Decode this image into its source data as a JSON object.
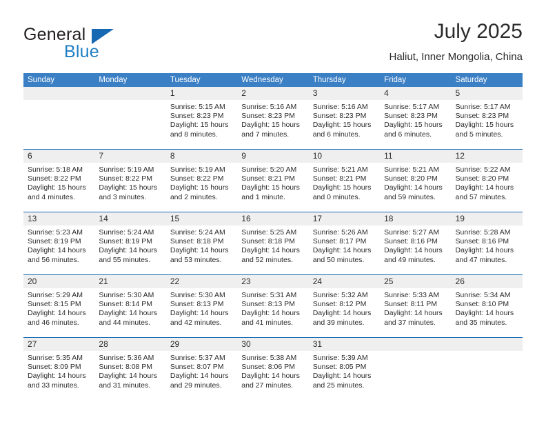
{
  "brand": {
    "name_part1": "General",
    "name_part2": "Blue",
    "triangle_color": "#1668b3",
    "blue_text_color": "#1f7fc4"
  },
  "header": {
    "title": "July 2025",
    "location": "Haliut, Inner Mongolia, China"
  },
  "theme": {
    "header_blue": "#3b7fc4",
    "separator_blue": "#1668b3",
    "number_band_gray": "#efefef",
    "text_color": "#2b2b2b"
  },
  "weekdays": [
    "Sunday",
    "Monday",
    "Tuesday",
    "Wednesday",
    "Thursday",
    "Friday",
    "Saturday"
  ],
  "weeks": [
    {
      "days": [
        {
          "num": "",
          "sunrise": "",
          "sunset": "",
          "daylight1": "",
          "daylight2": ""
        },
        {
          "num": "",
          "sunrise": "",
          "sunset": "",
          "daylight1": "",
          "daylight2": ""
        },
        {
          "num": "1",
          "sunrise": "Sunrise: 5:15 AM",
          "sunset": "Sunset: 8:23 PM",
          "daylight1": "Daylight: 15 hours",
          "daylight2": "and 8 minutes."
        },
        {
          "num": "2",
          "sunrise": "Sunrise: 5:16 AM",
          "sunset": "Sunset: 8:23 PM",
          "daylight1": "Daylight: 15 hours",
          "daylight2": "and 7 minutes."
        },
        {
          "num": "3",
          "sunrise": "Sunrise: 5:16 AM",
          "sunset": "Sunset: 8:23 PM",
          "daylight1": "Daylight: 15 hours",
          "daylight2": "and 6 minutes."
        },
        {
          "num": "4",
          "sunrise": "Sunrise: 5:17 AM",
          "sunset": "Sunset: 8:23 PM",
          "daylight1": "Daylight: 15 hours",
          "daylight2": "and 6 minutes."
        },
        {
          "num": "5",
          "sunrise": "Sunrise: 5:17 AM",
          "sunset": "Sunset: 8:23 PM",
          "daylight1": "Daylight: 15 hours",
          "daylight2": "and 5 minutes."
        }
      ]
    },
    {
      "days": [
        {
          "num": "6",
          "sunrise": "Sunrise: 5:18 AM",
          "sunset": "Sunset: 8:22 PM",
          "daylight1": "Daylight: 15 hours",
          "daylight2": "and 4 minutes."
        },
        {
          "num": "7",
          "sunrise": "Sunrise: 5:19 AM",
          "sunset": "Sunset: 8:22 PM",
          "daylight1": "Daylight: 15 hours",
          "daylight2": "and 3 minutes."
        },
        {
          "num": "8",
          "sunrise": "Sunrise: 5:19 AM",
          "sunset": "Sunset: 8:22 PM",
          "daylight1": "Daylight: 15 hours",
          "daylight2": "and 2 minutes."
        },
        {
          "num": "9",
          "sunrise": "Sunrise: 5:20 AM",
          "sunset": "Sunset: 8:21 PM",
          "daylight1": "Daylight: 15 hours",
          "daylight2": "and 1 minute."
        },
        {
          "num": "10",
          "sunrise": "Sunrise: 5:21 AM",
          "sunset": "Sunset: 8:21 PM",
          "daylight1": "Daylight: 15 hours",
          "daylight2": "and 0 minutes."
        },
        {
          "num": "11",
          "sunrise": "Sunrise: 5:21 AM",
          "sunset": "Sunset: 8:20 PM",
          "daylight1": "Daylight: 14 hours",
          "daylight2": "and 59 minutes."
        },
        {
          "num": "12",
          "sunrise": "Sunrise: 5:22 AM",
          "sunset": "Sunset: 8:20 PM",
          "daylight1": "Daylight: 14 hours",
          "daylight2": "and 57 minutes."
        }
      ]
    },
    {
      "days": [
        {
          "num": "13",
          "sunrise": "Sunrise: 5:23 AM",
          "sunset": "Sunset: 8:19 PM",
          "daylight1": "Daylight: 14 hours",
          "daylight2": "and 56 minutes."
        },
        {
          "num": "14",
          "sunrise": "Sunrise: 5:24 AM",
          "sunset": "Sunset: 8:19 PM",
          "daylight1": "Daylight: 14 hours",
          "daylight2": "and 55 minutes."
        },
        {
          "num": "15",
          "sunrise": "Sunrise: 5:24 AM",
          "sunset": "Sunset: 8:18 PM",
          "daylight1": "Daylight: 14 hours",
          "daylight2": "and 53 minutes."
        },
        {
          "num": "16",
          "sunrise": "Sunrise: 5:25 AM",
          "sunset": "Sunset: 8:18 PM",
          "daylight1": "Daylight: 14 hours",
          "daylight2": "and 52 minutes."
        },
        {
          "num": "17",
          "sunrise": "Sunrise: 5:26 AM",
          "sunset": "Sunset: 8:17 PM",
          "daylight1": "Daylight: 14 hours",
          "daylight2": "and 50 minutes."
        },
        {
          "num": "18",
          "sunrise": "Sunrise: 5:27 AM",
          "sunset": "Sunset: 8:16 PM",
          "daylight1": "Daylight: 14 hours",
          "daylight2": "and 49 minutes."
        },
        {
          "num": "19",
          "sunrise": "Sunrise: 5:28 AM",
          "sunset": "Sunset: 8:16 PM",
          "daylight1": "Daylight: 14 hours",
          "daylight2": "and 47 minutes."
        }
      ]
    },
    {
      "days": [
        {
          "num": "20",
          "sunrise": "Sunrise: 5:29 AM",
          "sunset": "Sunset: 8:15 PM",
          "daylight1": "Daylight: 14 hours",
          "daylight2": "and 46 minutes."
        },
        {
          "num": "21",
          "sunrise": "Sunrise: 5:30 AM",
          "sunset": "Sunset: 8:14 PM",
          "daylight1": "Daylight: 14 hours",
          "daylight2": "and 44 minutes."
        },
        {
          "num": "22",
          "sunrise": "Sunrise: 5:30 AM",
          "sunset": "Sunset: 8:13 PM",
          "daylight1": "Daylight: 14 hours",
          "daylight2": "and 42 minutes."
        },
        {
          "num": "23",
          "sunrise": "Sunrise: 5:31 AM",
          "sunset": "Sunset: 8:13 PM",
          "daylight1": "Daylight: 14 hours",
          "daylight2": "and 41 minutes."
        },
        {
          "num": "24",
          "sunrise": "Sunrise: 5:32 AM",
          "sunset": "Sunset: 8:12 PM",
          "daylight1": "Daylight: 14 hours",
          "daylight2": "and 39 minutes."
        },
        {
          "num": "25",
          "sunrise": "Sunrise: 5:33 AM",
          "sunset": "Sunset: 8:11 PM",
          "daylight1": "Daylight: 14 hours",
          "daylight2": "and 37 minutes."
        },
        {
          "num": "26",
          "sunrise": "Sunrise: 5:34 AM",
          "sunset": "Sunset: 8:10 PM",
          "daylight1": "Daylight: 14 hours",
          "daylight2": "and 35 minutes."
        }
      ]
    },
    {
      "days": [
        {
          "num": "27",
          "sunrise": "Sunrise: 5:35 AM",
          "sunset": "Sunset: 8:09 PM",
          "daylight1": "Daylight: 14 hours",
          "daylight2": "and 33 minutes."
        },
        {
          "num": "28",
          "sunrise": "Sunrise: 5:36 AM",
          "sunset": "Sunset: 8:08 PM",
          "daylight1": "Daylight: 14 hours",
          "daylight2": "and 31 minutes."
        },
        {
          "num": "29",
          "sunrise": "Sunrise: 5:37 AM",
          "sunset": "Sunset: 8:07 PM",
          "daylight1": "Daylight: 14 hours",
          "daylight2": "and 29 minutes."
        },
        {
          "num": "30",
          "sunrise": "Sunrise: 5:38 AM",
          "sunset": "Sunset: 8:06 PM",
          "daylight1": "Daylight: 14 hours",
          "daylight2": "and 27 minutes."
        },
        {
          "num": "31",
          "sunrise": "Sunrise: 5:39 AM",
          "sunset": "Sunset: 8:05 PM",
          "daylight1": "Daylight: 14 hours",
          "daylight2": "and 25 minutes."
        },
        {
          "num": "",
          "sunrise": "",
          "sunset": "",
          "daylight1": "",
          "daylight2": ""
        },
        {
          "num": "",
          "sunrise": "",
          "sunset": "",
          "daylight1": "",
          "daylight2": ""
        }
      ]
    }
  ]
}
